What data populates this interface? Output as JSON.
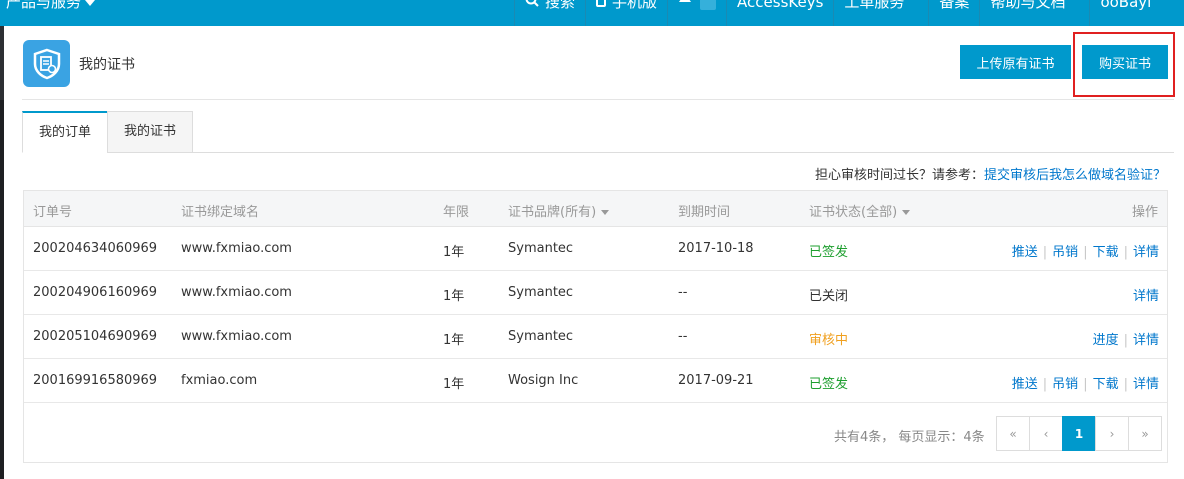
{
  "topbar": {
    "products_menu": "产品与服务",
    "search": "搜索",
    "mobile": "手机版",
    "bell_count": "0",
    "access_keys": "AccessKeys",
    "ticket": "工单服务",
    "beian": "备案",
    "help": "帮助与文档",
    "user": "ooBayi",
    "bar_color": "#0099cc"
  },
  "header": {
    "title": "我的证书",
    "upload_button": "上传原有证书",
    "buy_button": "购买证书"
  },
  "tabs": [
    {
      "label": "我的订单",
      "active": true
    },
    {
      "label": "我的证书",
      "active": false
    }
  ],
  "hint": {
    "text": "担心审核时间过长？请参考：",
    "link": "提交审核后我怎么做域名验证？"
  },
  "table": {
    "columns": {
      "order_no": "订单号",
      "domain": "证书绑定域名",
      "years": "年限",
      "brand": "证书品牌(所有)",
      "expiry": "到期时间",
      "status": "证书状态(全部)",
      "actions": "操作"
    },
    "rows": [
      {
        "order_no": "200204634060969",
        "domain": "www.fxmiao.com",
        "years": "1年",
        "brand": "Symantec",
        "expiry": "2017-10-18",
        "status": "已签发",
        "status_color": "#1e9f2f",
        "actions": [
          "推送",
          "吊销",
          "下载",
          "详情"
        ]
      },
      {
        "order_no": "200204906160969",
        "domain": "www.fxmiao.com",
        "years": "1年",
        "brand": "Symantec",
        "expiry": "--",
        "status": "已关闭",
        "status_color": "#333333",
        "actions": [
          "详情"
        ]
      },
      {
        "order_no": "200205104690969",
        "domain": "www.fxmiao.com",
        "years": "1年",
        "brand": "Symantec",
        "expiry": "--",
        "status": "审核中",
        "status_color": "#f0a020",
        "actions": [
          "进度",
          "详情"
        ]
      },
      {
        "order_no": "200169916580969",
        "domain": "fxmiao.com",
        "years": "1年",
        "brand": "Wosign Inc",
        "expiry": "2017-09-21",
        "status": "已签发",
        "status_color": "#1e9f2f",
        "actions": [
          "推送",
          "吊销",
          "下载",
          "详情"
        ]
      }
    ]
  },
  "pagination": {
    "summary": "共有4条， 每页显示：4条",
    "first": "«",
    "prev": "‹",
    "current": "1",
    "next": "›",
    "last": "»"
  }
}
